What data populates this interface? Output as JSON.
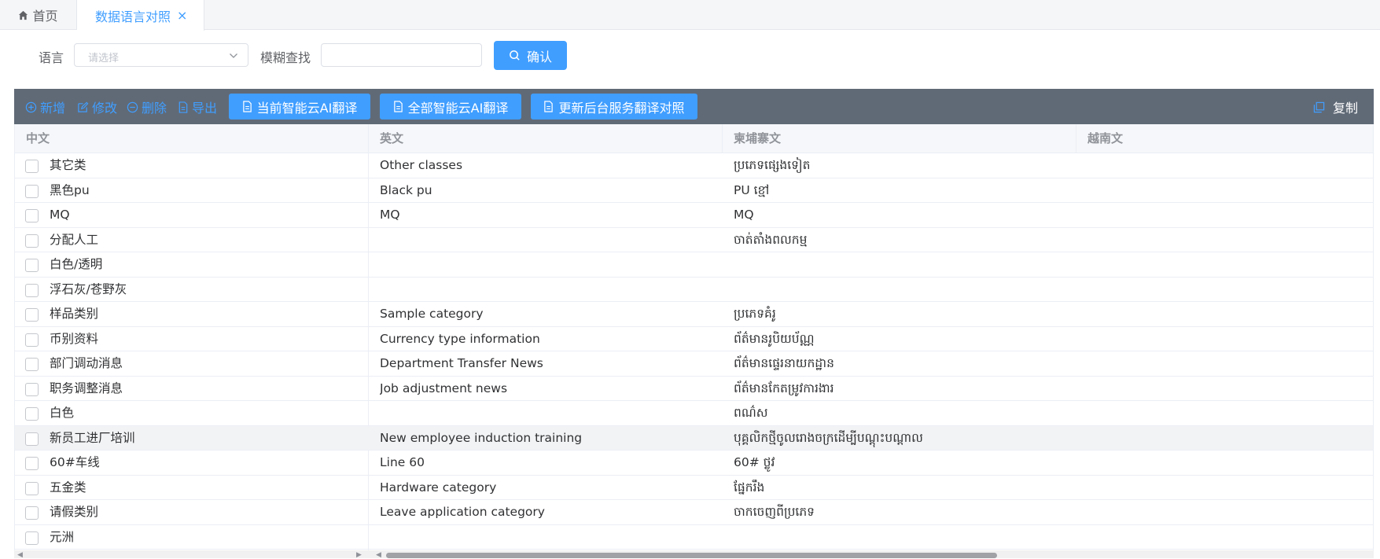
{
  "tabs": {
    "home_label": "首页",
    "active_label": "数据语言对照",
    "close_glyph": "×"
  },
  "search": {
    "language_label": "语言",
    "language_placeholder": "请选择",
    "fuzzy_label": "模糊查找",
    "fuzzy_value": "",
    "confirm_label": "确认"
  },
  "toolbar": {
    "add": "新增",
    "edit": "修改",
    "delete": "删除",
    "export": "导出",
    "ai_current": "当前智能云AI翻译",
    "ai_all": "全部智能云AI翻译",
    "update_backend": "更新后台服务翻译对照",
    "copy": "复制"
  },
  "table": {
    "columns": [
      "中文",
      "英文",
      "柬埔寨文",
      "越南文"
    ],
    "rows": [
      {
        "zh": "其它类",
        "en": "Other classes",
        "km": "ប្រភេទផ្សេងទៀត",
        "vi": ""
      },
      {
        "zh": "黑色pu",
        "en": "Black pu",
        "km": "PU ខ្មៅ",
        "vi": ""
      },
      {
        "zh": "MQ",
        "en": "MQ",
        "km": "MQ",
        "vi": ""
      },
      {
        "zh": "分配人工",
        "en": "",
        "km": "ចាត់តាំងពលកម្ម",
        "vi": ""
      },
      {
        "zh": "白色/透明",
        "en": "",
        "km": "",
        "vi": ""
      },
      {
        "zh": "浮石灰/苍野灰",
        "en": "",
        "km": "",
        "vi": ""
      },
      {
        "zh": "样品类别",
        "en": "Sample category",
        "km": "ប្រភេទគំរូ",
        "vi": ""
      },
      {
        "zh": "币别资料",
        "en": "Currency type information",
        "km": "ព័ត៌មានរូបិយប័ណ្ណ",
        "vi": ""
      },
      {
        "zh": "部门调动消息",
        "en": "Department Transfer News",
        "km": "ព័ត៌មានផ្ទេរនាយកដ្ឋាន",
        "vi": ""
      },
      {
        "zh": "职务调整消息",
        "en": "Job adjustment news",
        "km": "ព័ត៌មានកែតម្រូវការងារ",
        "vi": ""
      },
      {
        "zh": "白色",
        "en": "",
        "km": "ពណ៌ស",
        "vi": ""
      },
      {
        "zh": "新员工进厂培训",
        "en": "New employee induction training",
        "km": "បុគ្គលិកថ្មីចូលរោងចក្រដើម្បីបណ្តុះបណ្តាល",
        "vi": ""
      },
      {
        "zh": "60#车线",
        "en": "Line 60",
        "km": "60# ថ្លូវ",
        "vi": ""
      },
      {
        "zh": "五金类",
        "en": "Hardware category",
        "km": "ផ្នែករឹង",
        "vi": ""
      },
      {
        "zh": "请假类别",
        "en": "Leave application category",
        "km": "ចាកចេញពីប្រភេទ",
        "vi": ""
      },
      {
        "zh": "元洲",
        "en": "",
        "km": "",
        "vi": ""
      }
    ]
  },
  "colors": {
    "accent": "#409eff",
    "toolbar_bg": "#606a77",
    "header_bg": "#f5f7fa"
  }
}
